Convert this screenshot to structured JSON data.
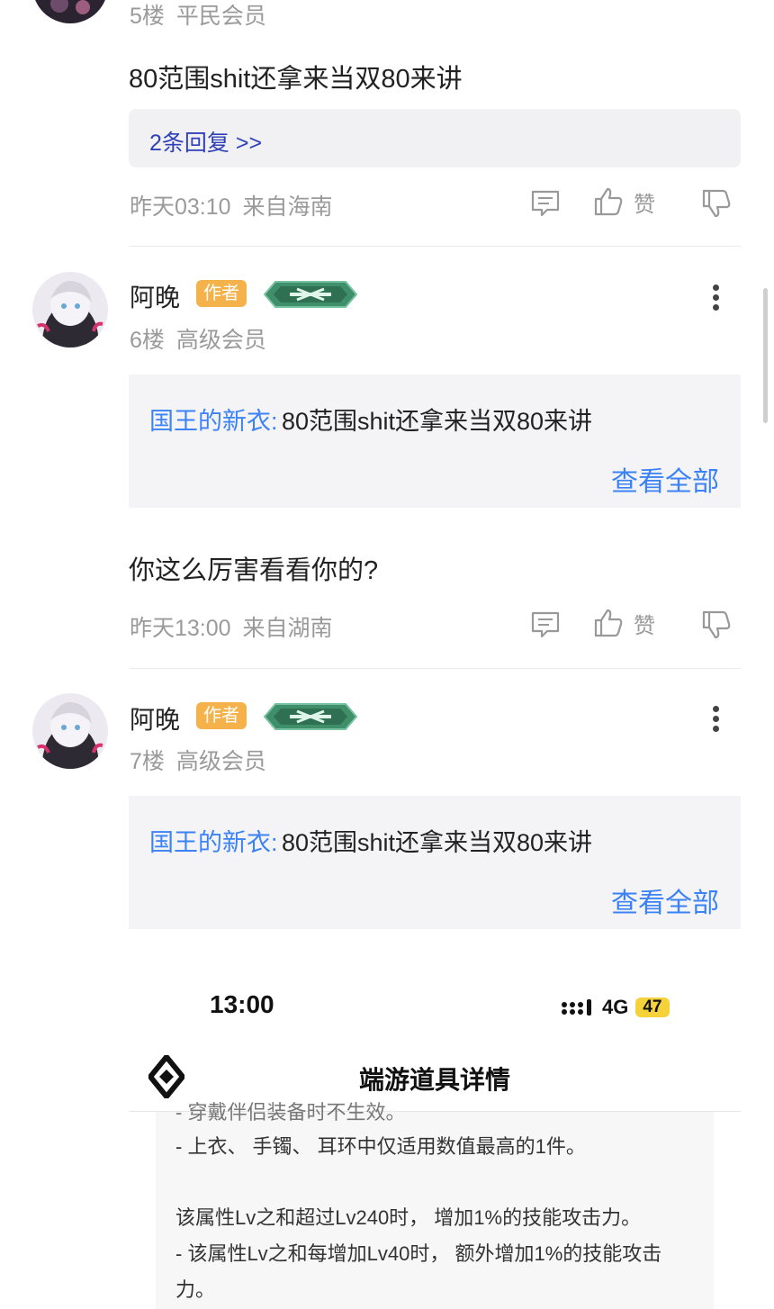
{
  "post5": {
    "floor": "5楼",
    "level": "平民会员",
    "content": "80范围shit还拿来当双80来讲",
    "replies_link": "2条回复 >>",
    "time": "昨天03:10",
    "location": "来自海南",
    "like_label": "赞"
  },
  "post6": {
    "username": "阿晚",
    "author_badge": "作者",
    "floor": "6楼",
    "level": "高级会员",
    "quote_author": "国王的新衣:",
    "quote_text": "80范围shit还拿来当双80来讲",
    "view_all": "查看全部",
    "content": "你这么厉害看看你的?",
    "time": "昨天13:00",
    "location": "来自湖南",
    "like_label": "赞"
  },
  "post7": {
    "username": "阿晚",
    "author_badge": "作者",
    "floor": "7楼",
    "level": "高级会员",
    "quote_author": "国王的新衣:",
    "quote_text": "80范围shit还拿来当双80来讲",
    "view_all": "查看全部"
  },
  "embedded": {
    "status_time": "13:00",
    "network": "4G",
    "battery": "47",
    "title": "端游道具详情",
    "line0": "- 穿戴伴侣装备时不生效。",
    "line1": "- 上衣、 手镯、 耳环中仅适用数值最高的1件。",
    "line2": "该属性Lv之和超过Lv240时， 增加1%的技能攻击力。",
    "line3": "- 该属性Lv之和每增加Lv40时， 额外增加1%的技能攻击",
    "line4": "力。"
  },
  "colors": {
    "link_blue": "#3b82f6",
    "author_badge": "#f6b24a",
    "reply_link": "#3040b8",
    "level_badge_green": "#3f8f6a"
  }
}
